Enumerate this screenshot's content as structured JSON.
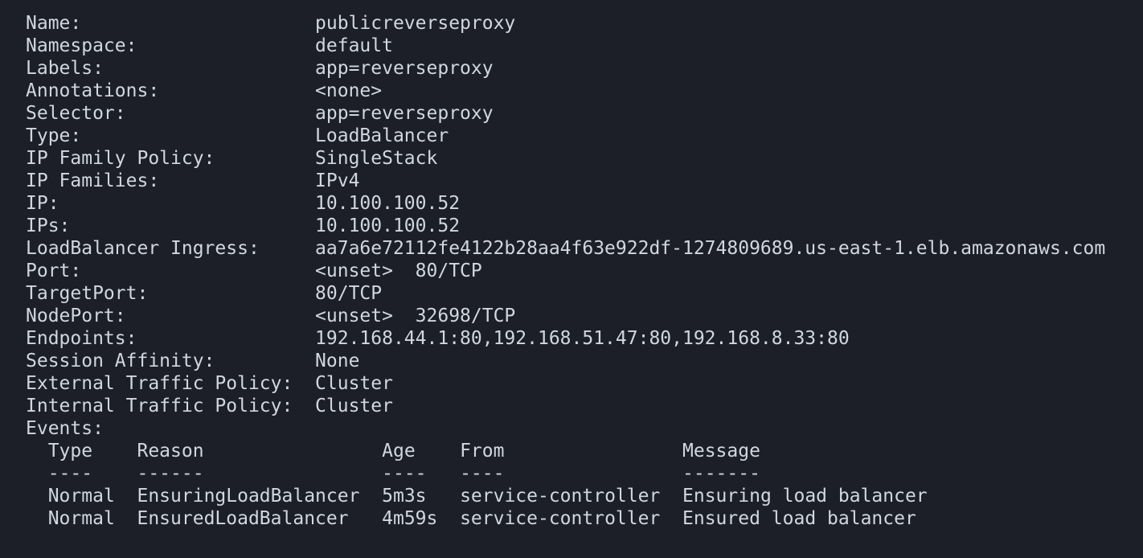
{
  "service": {
    "fields": [
      {
        "label": "Name:",
        "value": "publicreverseproxy"
      },
      {
        "label": "Namespace:",
        "value": "default"
      },
      {
        "label": "Labels:",
        "value": "app=reverseproxy"
      },
      {
        "label": "Annotations:",
        "value": "<none>"
      },
      {
        "label": "Selector:",
        "value": "app=reverseproxy"
      },
      {
        "label": "Type:",
        "value": "LoadBalancer"
      },
      {
        "label": "IP Family Policy:",
        "value": "SingleStack"
      },
      {
        "label": "IP Families:",
        "value": "IPv4"
      },
      {
        "label": "IP:",
        "value": "10.100.100.52"
      },
      {
        "label": "IPs:",
        "value": "10.100.100.52"
      },
      {
        "label": "LoadBalancer Ingress:",
        "value": "aa7a6e72112fe4122b28aa4f63e922df-1274809689.us-east-1.elb.amazonaws.com"
      },
      {
        "label": "Port:",
        "value": "<unset>  80/TCP"
      },
      {
        "label": "TargetPort:",
        "value": "80/TCP"
      },
      {
        "label": "NodePort:",
        "value": "<unset>  32698/TCP"
      },
      {
        "label": "Endpoints:",
        "value": "192.168.44.1:80,192.168.51.47:80,192.168.8.33:80"
      },
      {
        "label": "Session Affinity:",
        "value": "None"
      },
      {
        "label": "External Traffic Policy:",
        "value": "Cluster"
      },
      {
        "label": "Internal Traffic Policy:",
        "value": "Cluster"
      }
    ],
    "events_label": "Events:",
    "events": {
      "headers": [
        "Type",
        "Reason",
        "Age",
        "From",
        "Message"
      ],
      "separators": [
        "----",
        "------",
        "----",
        "----",
        "-------"
      ],
      "rows": [
        [
          "Normal",
          "EnsuringLoadBalancer",
          "5m3s",
          "service-controller",
          "Ensuring load balancer"
        ],
        [
          "Normal",
          "EnsuredLoadBalancer",
          "4m59s",
          "service-controller",
          "Ensured load balancer"
        ]
      ]
    }
  }
}
